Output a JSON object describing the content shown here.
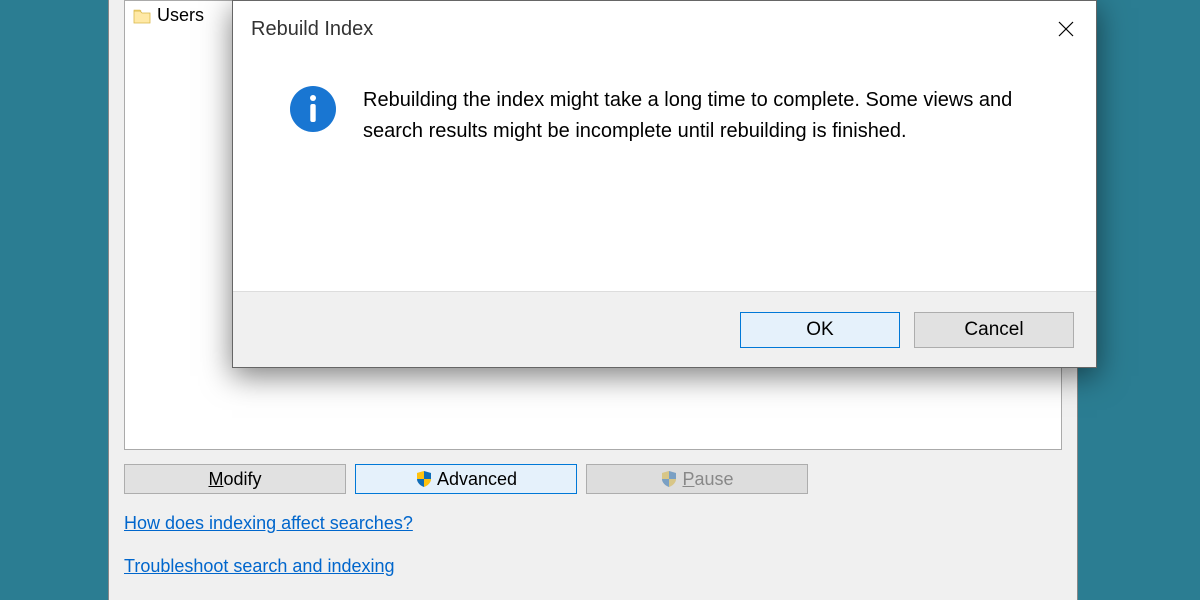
{
  "main": {
    "listbox": {
      "items": [
        {
          "label": "Users"
        }
      ]
    },
    "buttons": {
      "modify": {
        "mnemonic": "M",
        "rest": "odify"
      },
      "advanced": {
        "label": "Advanced"
      },
      "pause": {
        "mnemonic": "P",
        "rest": "ause"
      }
    },
    "links": {
      "searches": "How does indexing affect searches?",
      "troubleshoot": "Troubleshoot search and indexing"
    }
  },
  "modal": {
    "title": "Rebuild Index",
    "body": "Rebuilding the index might take a long time to complete. Some views and search results might be incomplete until rebuilding is finished.",
    "ok": "OK",
    "cancel": "Cancel"
  }
}
